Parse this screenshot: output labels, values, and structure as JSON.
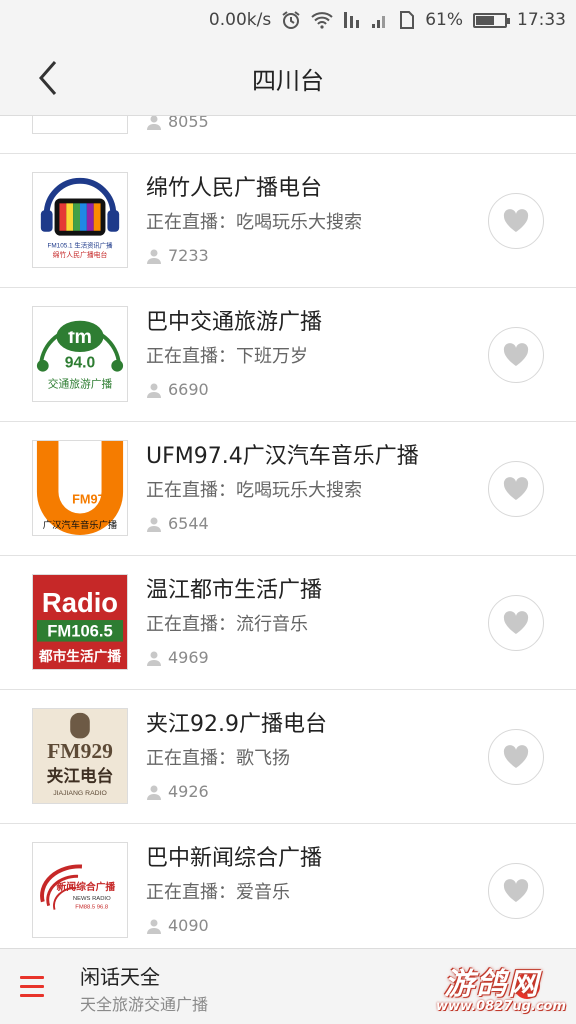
{
  "status": {
    "net_speed": "0.00k/s",
    "battery_pct": "61%",
    "battery_level": 0.61,
    "time": "17:33"
  },
  "header": {
    "title": "四川台"
  },
  "now_label": "正在直播：",
  "stations": [
    {
      "name": "",
      "now": "",
      "listeners": "8055"
    },
    {
      "name": "绵竹人民广播电台",
      "now": "正在直播：吃喝玩乐大搜索",
      "listeners": "7233",
      "logo_text": [
        "FM105.1 生活资讯广播",
        "绵竹人民广播电台"
      ]
    },
    {
      "name": "巴中交通旅游广播",
      "now": "正在直播：下班万岁",
      "listeners": "6690",
      "logo_text": [
        "fm",
        "94.0",
        "交通旅游广播"
      ]
    },
    {
      "name": "UFM97.4广汉汽车音乐广播",
      "now": "正在直播：吃喝玩乐大搜索",
      "listeners": "6544",
      "logo_text": [
        "U",
        "FM97.4",
        "广汉汽车音乐广播"
      ]
    },
    {
      "name": "温江都市生活广播",
      "now": "正在直播：流行音乐",
      "listeners": "4969",
      "logo_text": [
        "Radio",
        "FM106.5",
        "都市生活广播"
      ]
    },
    {
      "name": "夹江92.9广播电台",
      "now": "正在直播：歌飞扬",
      "listeners": "4926",
      "logo_text": [
        "FM929",
        "夹江电台",
        "JIAJIANG RADIO"
      ]
    },
    {
      "name": "巴中新闻综合广播",
      "now": "正在直播：爱音乐",
      "listeners": "4090",
      "logo_text": [
        "新闻综合广播",
        "NEWS RADIO",
        "FM88.5 96.8"
      ]
    }
  ],
  "player": {
    "title": "闲话天全",
    "subtitle": "天全旅游交通广播"
  },
  "watermark": {
    "main": "游鸽网",
    "url": "www.0827ug.com"
  },
  "colors": {
    "accent": "#e8332a",
    "bar_bg": "#f4f4f4"
  }
}
